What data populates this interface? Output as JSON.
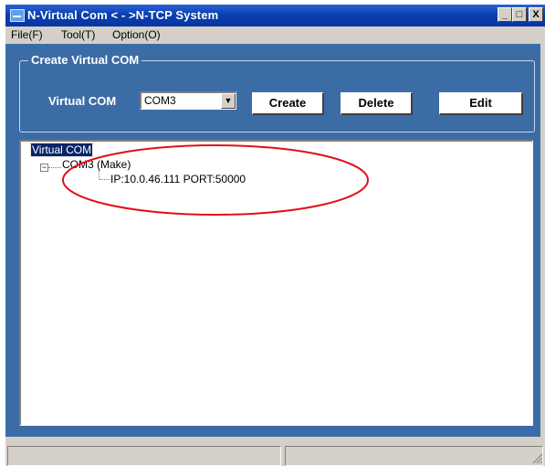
{
  "window": {
    "title": "N-Virtual Com < - >N-TCP System",
    "minimize_glyph": "_",
    "maximize_glyph": "□",
    "close_glyph": "X"
  },
  "menu": {
    "items": [
      {
        "label": "File(F)"
      },
      {
        "label": "Tool(T)"
      },
      {
        "label": "Option(O)"
      }
    ]
  },
  "create_group": {
    "legend": "Create Virtual COM",
    "virtual_com_label": "Virtual COM",
    "combo_value": "COM3",
    "buttons": {
      "create": "Create",
      "delete": "Delete",
      "edit": "Edit"
    }
  },
  "tree": {
    "root": "Virtual COM",
    "expander_glyph": "−",
    "child": "COM3 (Make)",
    "grandchild": "IP:10.0.46.111  PORT:50000"
  },
  "annotation": {
    "ellipse_color": "#e0101a"
  },
  "colors": {
    "titlebar": "#0a3fb0",
    "panel_background": "#3c6ca6",
    "selection": "#0a246a"
  },
  "icons": [
    "app-icon",
    "minimize-icon",
    "maximize-icon",
    "close-icon",
    "dropdown-arrow-icon",
    "tree-expander-icon",
    "resize-grip-icon"
  ]
}
